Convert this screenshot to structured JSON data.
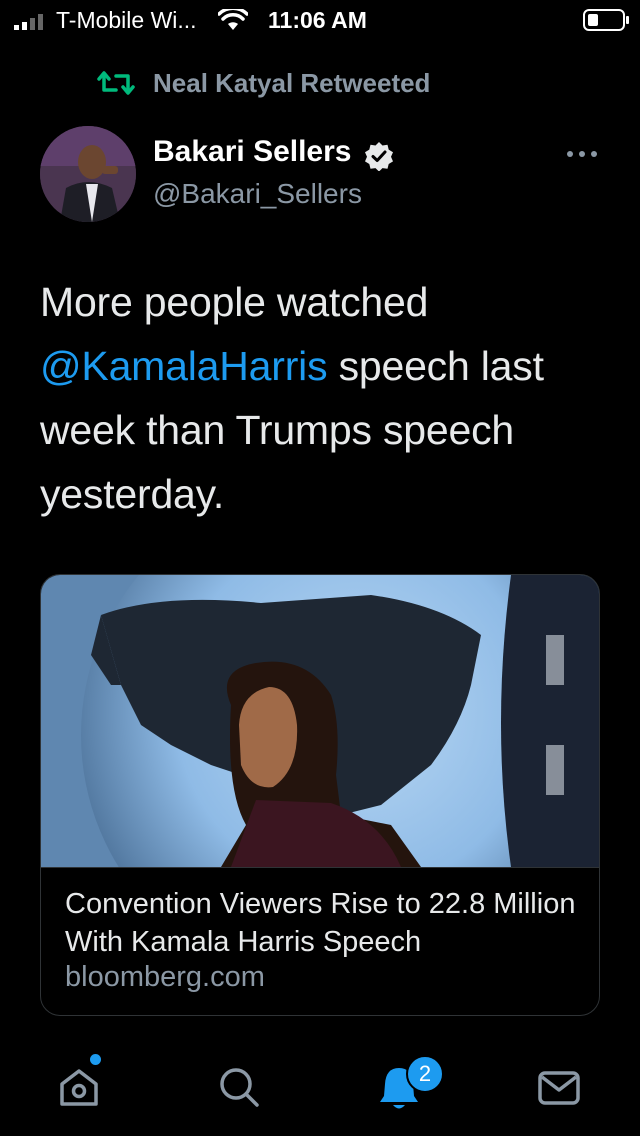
{
  "status_bar": {
    "carrier": "T-Mobile Wi...",
    "time": "11:06 AM",
    "icons": [
      "signal-icon",
      "wifi-icon",
      "battery-icon"
    ]
  },
  "retweet": {
    "icon": "retweet-icon",
    "label": "Neal Katyal Retweeted"
  },
  "author": {
    "name": "Bakari Sellers",
    "handle": "@Bakari_Sellers",
    "verified": true
  },
  "tweet": {
    "text_before": "More people watched ",
    "mention": "@KamalaHarris",
    "text_after": " speech last week than Trumps speech yesterday."
  },
  "link_card": {
    "title": "Convention Viewers Rise to 22.8 Million With Kamala Harris Speech",
    "domain": "bloomberg.com"
  },
  "nav": {
    "items": [
      "home-icon",
      "search-icon",
      "notifications-icon",
      "messages-icon"
    ],
    "notification_count": "2"
  },
  "colors": {
    "background": "#000000",
    "accent": "#1d9bf0",
    "retweet_green": "#00ba7c",
    "secondary_text": "#8b98a5"
  }
}
